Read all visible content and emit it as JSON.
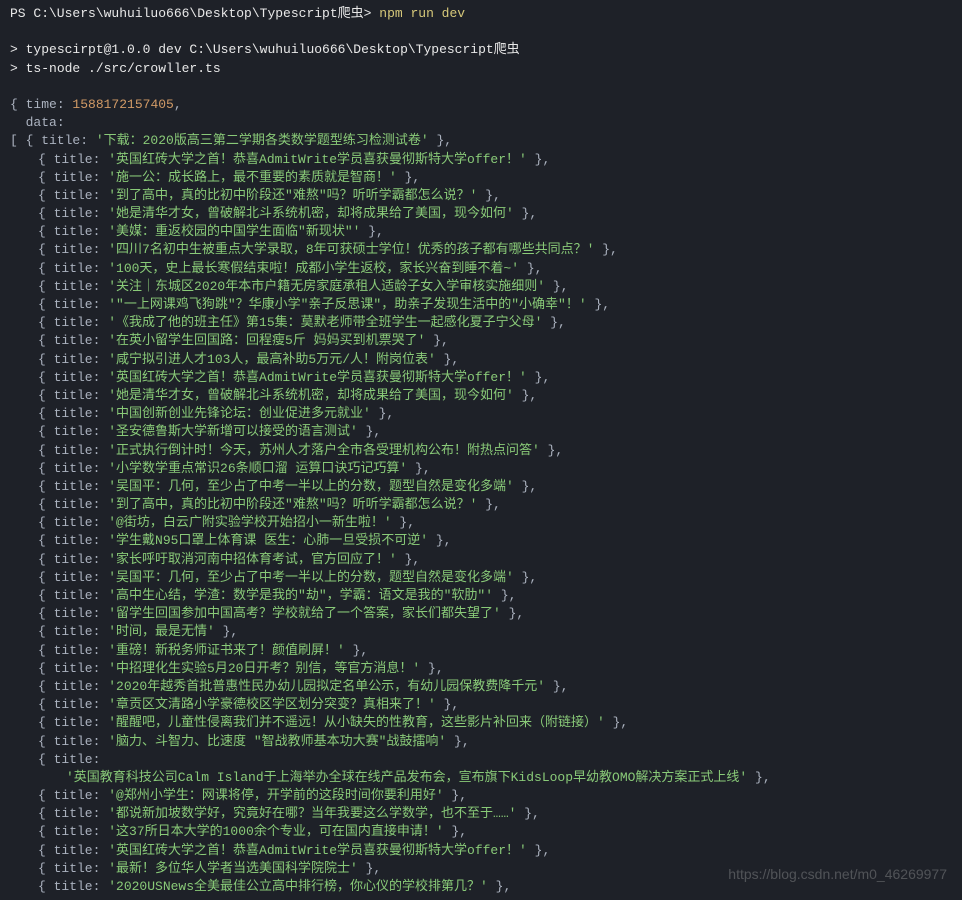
{
  "prompt": {
    "ps": "PS ",
    "path": "C:\\Users\\wuhuiluo666\\Desktop\\Typescript爬虫",
    "arrow": "> ",
    "command": "npm run dev"
  },
  "echo": {
    "line1": "typescirpt@1.0.0 dev C:\\Users\\wuhuiluo666\\Desktop\\Typescript爬虫",
    "line2": "ts-node ./src/crowller.ts"
  },
  "output": {
    "open": "{ ",
    "timeKey": "time:",
    "time": " 1588172157405",
    "comma": ",",
    "dataKey": "data:",
    "arrayOpen": "   [ ",
    "items": [
      {
        "t": "'下载：2020版高三第二学期各类数学题型练习检测试卷'",
        "first": true
      },
      {
        "t": "'英国红砖大学之首！恭喜AdmitWrite学员喜获曼彻斯特大学offer！'"
      },
      {
        "t": "'施一公：成长路上，最不重要的素质就是智商！'"
      },
      {
        "t": "'到了高中，真的比初中阶段还\"难熬\"吗？听听学霸都怎么说？'"
      },
      {
        "t": "'她是清华才女，曾破解北斗系统机密，却将成果给了美国，现今如何'"
      },
      {
        "t": "'美媒：重返校园的中国学生面临\"新现状\"'"
      },
      {
        "t": "'四川7名初中生被重点大学录取，8年可获硕士学位！优秀的孩子都有哪些共同点？'"
      },
      {
        "t": "'100天，史上最长寒假结束啦！成都小学生返校，家长兴奋到睡不着~'"
      },
      {
        "t": "'关注｜东城区2020年本市户籍无房家庭承租人适龄子女入学审核实施细则'"
      },
      {
        "t": "'\"一上网课鸡飞狗跳\"？华康小学\"亲子反思课\"，助亲子发现生活中的\"小确幸\"！'"
      },
      {
        "t": "'《我成了他的班主任》第15集：莫默老师带全班学生一起感化夏子宁父母'"
      },
      {
        "t": "'在英小留学生回国路：回程瘦5斤 妈妈买到机票哭了'"
      },
      {
        "t": "'咸宁拟引进人才103人，最高补助5万元/人！附岗位表'"
      },
      {
        "t": "'英国红砖大学之首！恭喜AdmitWrite学员喜获曼彻斯特大学offer！'"
      },
      {
        "t": "'她是清华才女，曾破解北斗系统机密，却将成果给了美国，现今如何'"
      },
      {
        "t": "'中国创新创业先锋论坛：创业促进多元就业'"
      },
      {
        "t": "'圣安德鲁斯大学新增可以接受的语言测试'"
      },
      {
        "t": "'正式执行倒计时！今天，苏州人才落户全市各受理机构公布！附热点问答'"
      },
      {
        "t": "'小学数学重点常识26条顺口溜 运算口诀巧记巧算'"
      },
      {
        "t": "'吴国平：几何，至少占了中考一半以上的分数，题型自然是变化多端'"
      },
      {
        "t": "'到了高中，真的比初中阶段还\"难熬\"吗？听听学霸都怎么说？'"
      },
      {
        "t": "'@街坊，白云广附实验学校开始招小一新生啦！'"
      },
      {
        "t": "'学生戴N95口罩上体育课 医生：心肺一旦受损不可逆'"
      },
      {
        "t": "'家长呼吁取消河南中招体育考试，官方回应了！'"
      },
      {
        "t": "'吴国平：几何，至少占了中考一半以上的分数，题型自然是变化多端'"
      },
      {
        "t": "'高中生心结，学渣：数学是我的\"劫\"，学霸：语文是我的\"软肋\"'"
      },
      {
        "t": "'留学生回国参加中国高考？学校就给了一个答案，家长们都失望了'"
      },
      {
        "t": "'时间，最是无情'"
      },
      {
        "t": "'重磅！新税务师证书来了！颜值刷屏！'"
      },
      {
        "t": "'中招理化生实验5月20日开考？别信，等官方消息！'"
      },
      {
        "t": "'2020年越秀首批普惠性民办幼儿园拟定名单公示，有幼儿园保教费降千元'"
      },
      {
        "t": "'章贡区文清路小学豪德校区学区划分突变？真相来了！'"
      },
      {
        "t": "'醒醒吧，儿童性侵离我们并不遥远！从小缺失的性教育，这些影片补回来（附链接）'"
      },
      {
        "t": "'脑力、斗智力、比速度 \"智战教师基本功大赛\"战鼓擂响'"
      },
      {
        "special": "wrap",
        "t": "'英国教育科技公司Calm Island于上海举办全球在线产品发布会，宣布旗下KidsLoop早幼教OMO解决方案正式上线'"
      },
      {
        "t": "'@郑州小学生：网课将停，开学前的这段时间你要利用好'"
      },
      {
        "t": "'都说新加坡数学好，究竟好在哪？当年我要这么学数学，也不至于……'"
      },
      {
        "t": "'这37所日本大学的1000余个专业，可在国内直接申请！'"
      },
      {
        "t": "'英国红砖大学之首！恭喜AdmitWrite学员喜获曼彻斯特大学offer！'"
      },
      {
        "t": "'最新！多位华人学者当选美国科学院院士'"
      },
      {
        "t": "'2020USNews全美最佳公立高中排行榜，你心仪的学校排第几？'"
      }
    ]
  },
  "watermark": "https://blog.csdn.net/m0_46269977"
}
